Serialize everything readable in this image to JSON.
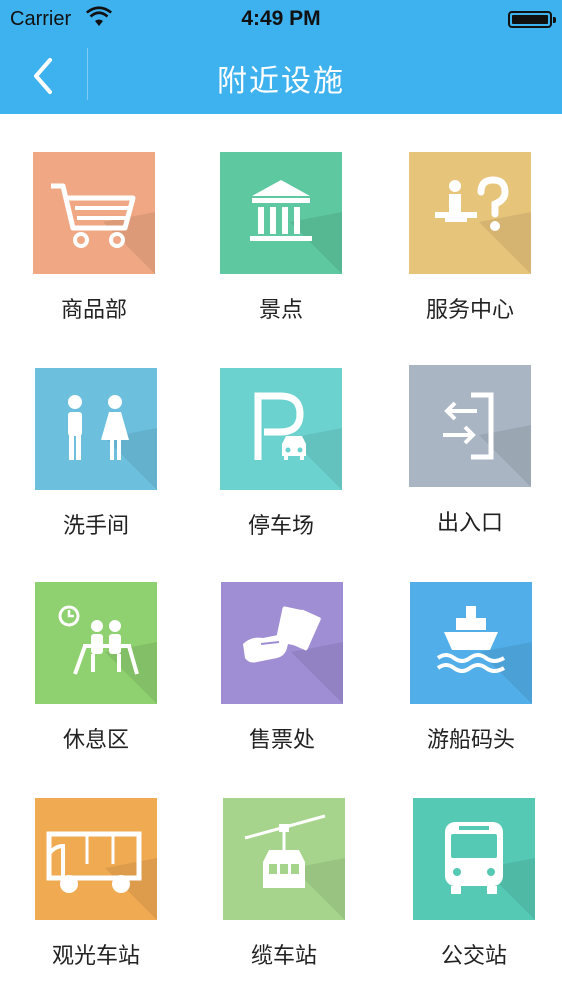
{
  "status": {
    "carrier": "Carrier",
    "time": "4:49 PM"
  },
  "header": {
    "title": "附近设施"
  },
  "colors": {
    "header_bg": "#3eb1ef",
    "tiles": [
      "#f0a884",
      "#5ec8a0",
      "#e6c47a",
      "#6cc0de",
      "#6cd2cf",
      "#a9b5c3",
      "#8fd070",
      "#a08ed4",
      "#52aee8",
      "#efaa52",
      "#a6d48c",
      "#56c9b5"
    ]
  },
  "facilities": [
    {
      "label": "商品部",
      "icon": "shopping-cart-icon"
    },
    {
      "label": "景点",
      "icon": "landmark-icon"
    },
    {
      "label": "服务中心",
      "icon": "service-help-icon"
    },
    {
      "label": "洗手间",
      "icon": "restroom-icon"
    },
    {
      "label": "停车场",
      "icon": "parking-icon"
    },
    {
      "label": "出入口",
      "icon": "entrance-exit-icon"
    },
    {
      "label": "休息区",
      "icon": "rest-area-icon"
    },
    {
      "label": "售票处",
      "icon": "ticket-icon"
    },
    {
      "label": "游船码头",
      "icon": "ship-icon"
    },
    {
      "label": "观光车站",
      "icon": "tour-bus-icon"
    },
    {
      "label": "缆车站",
      "icon": "cable-car-icon"
    },
    {
      "label": "公交站",
      "icon": "bus-icon"
    }
  ]
}
